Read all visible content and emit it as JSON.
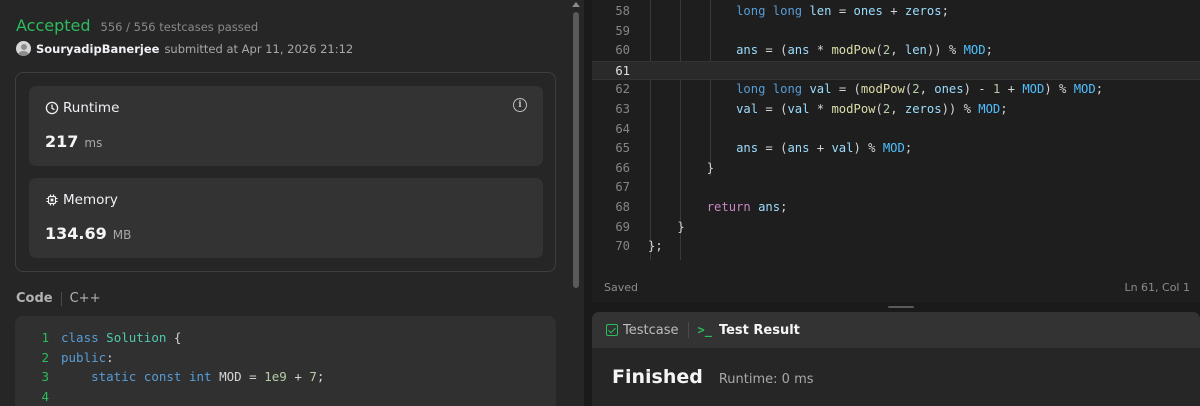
{
  "submission": {
    "status": "Accepted",
    "testcases": "556 / 556 testcases passed",
    "username": "SouryadipBanerjee",
    "submitted_at": "submitted at Apr 11, 2026 21:12"
  },
  "runtime": {
    "label": "Runtime",
    "value": "217",
    "unit": "ms"
  },
  "memory": {
    "label": "Memory",
    "value": "134.69",
    "unit": "MB"
  },
  "code_header": {
    "label": "Code",
    "language": "C++"
  },
  "left_code": [
    {
      "num": "1",
      "text": "class Solution {"
    },
    {
      "num": "2",
      "text": "public:"
    },
    {
      "num": "3",
      "text": "    static const int MOD = 1e9 + 7;"
    },
    {
      "num": "4",
      "text": ""
    }
  ],
  "editor": {
    "line_numbers": [
      "58",
      "59",
      "60",
      "61",
      "62",
      "63",
      "64",
      "65",
      "66",
      "67",
      "68",
      "69",
      "70"
    ],
    "active_line": "61",
    "saved_label": "Saved",
    "cursor_pos": "Ln 61, Col 1"
  },
  "test_panel": {
    "tab_testcase": "Testcase",
    "tab_result": "Test Result",
    "result_title": "Finished",
    "result_runtime": "Runtime: 0 ms"
  },
  "colors": {
    "accepted": "#2cbb5d",
    "keyword": "#569cd6",
    "control": "#c586c0",
    "function": "#dcdcaa"
  }
}
